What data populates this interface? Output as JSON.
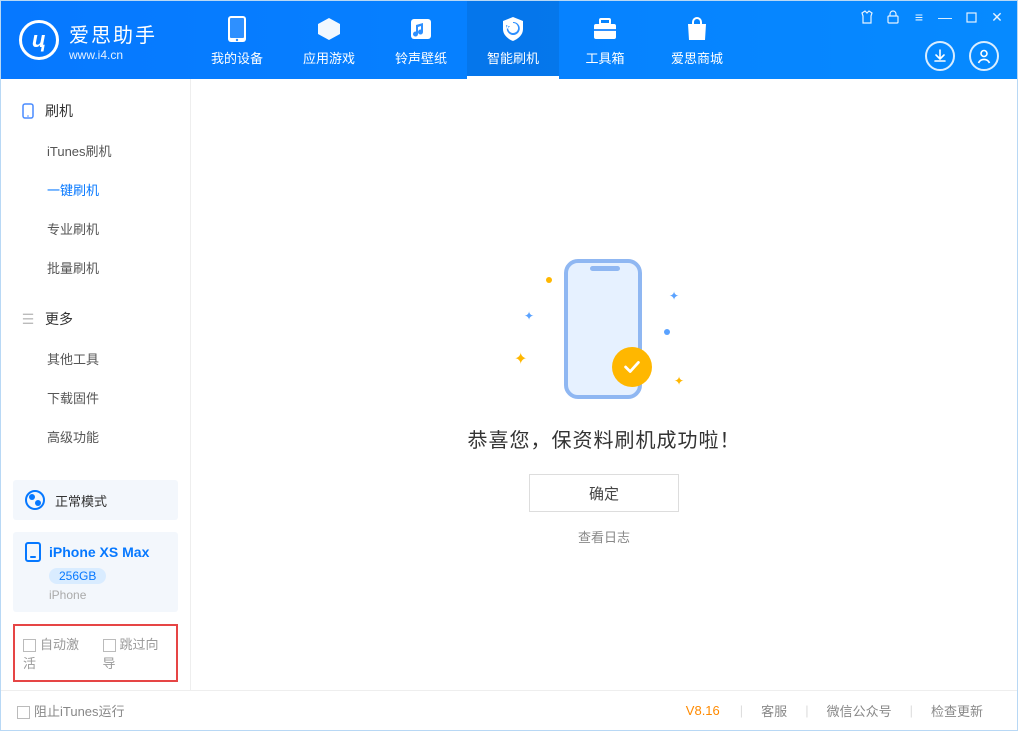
{
  "header": {
    "logo_cn": "爱思助手",
    "logo_url": "www.i4.cn",
    "nav": [
      {
        "label": "我的设备"
      },
      {
        "label": "应用游戏"
      },
      {
        "label": "铃声壁纸"
      },
      {
        "label": "智能刷机"
      },
      {
        "label": "工具箱"
      },
      {
        "label": "爱思商城"
      }
    ]
  },
  "sidebar": {
    "group1": {
      "title": "刷机",
      "items": [
        {
          "label": "iTunes刷机"
        },
        {
          "label": "一键刷机"
        },
        {
          "label": "专业刷机"
        },
        {
          "label": "批量刷机"
        }
      ]
    },
    "group2": {
      "title": "更多",
      "items": [
        {
          "label": "其他工具"
        },
        {
          "label": "下载固件"
        },
        {
          "label": "高级功能"
        }
      ]
    },
    "mode": {
      "label": "正常模式"
    },
    "device": {
      "name": "iPhone XS Max",
      "capacity": "256GB",
      "type": "iPhone"
    },
    "options": {
      "opt1": "自动激活",
      "opt2": "跳过向导"
    }
  },
  "content": {
    "success": "恭喜您，保资料刷机成功啦！",
    "ok": "确定",
    "log_link": "查看日志"
  },
  "footer": {
    "block_itunes": "阻止iTunes运行",
    "version": "V8.16",
    "links": [
      "客服",
      "微信公众号",
      "检查更新"
    ]
  }
}
